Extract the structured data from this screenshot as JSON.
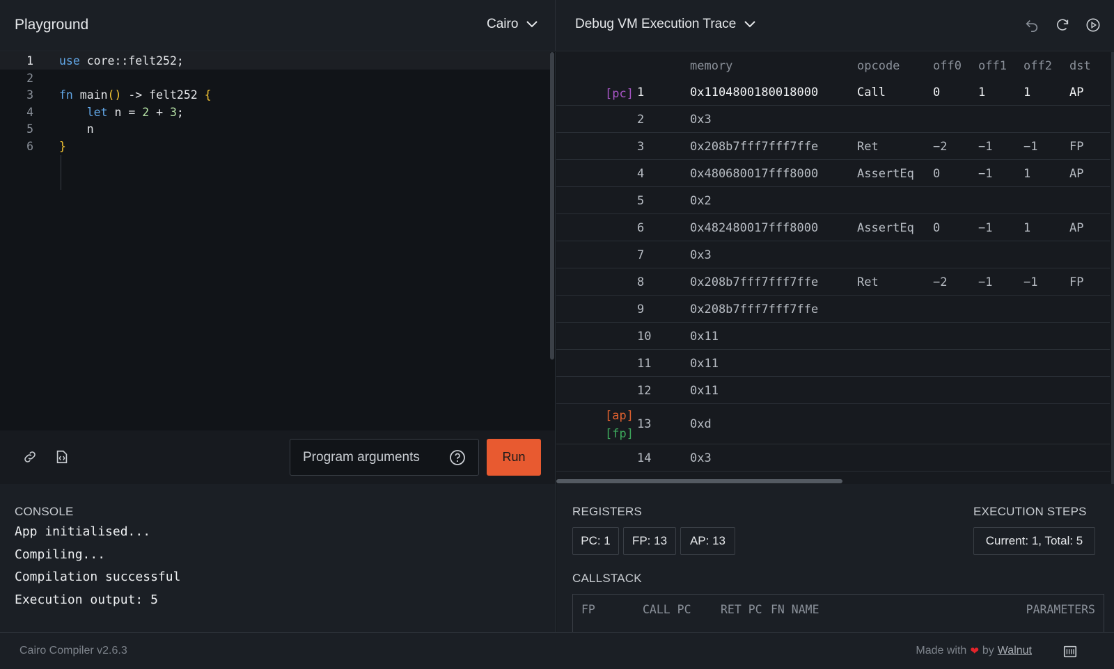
{
  "header": {
    "app_title": "Playground",
    "language": "Cairo",
    "mode": "Debug VM Execution Trace"
  },
  "editor": {
    "lines": [
      {
        "n": "1",
        "tokens": [
          {
            "t": "use",
            "k": "kw"
          },
          {
            "t": " core::felt252;",
            "k": ""
          }
        ]
      },
      {
        "n": "2",
        "tokens": []
      },
      {
        "n": "3",
        "tokens": [
          {
            "t": "fn",
            "k": "kw"
          },
          {
            "t": " main",
            "k": ""
          },
          {
            "t": "()",
            "k": "br"
          },
          {
            "t": " -> felt252 ",
            "k": ""
          },
          {
            "t": "{",
            "k": "br"
          }
        ]
      },
      {
        "n": "4",
        "tokens": [
          {
            "t": "    ",
            "k": ""
          },
          {
            "t": "let",
            "k": "kw"
          },
          {
            "t": " n = ",
            "k": ""
          },
          {
            "t": "2",
            "k": "num"
          },
          {
            "t": " + ",
            "k": ""
          },
          {
            "t": "3",
            "k": "num"
          },
          {
            "t": ";",
            "k": ""
          }
        ]
      },
      {
        "n": "5",
        "tokens": [
          {
            "t": "    n",
            "k": ""
          }
        ]
      },
      {
        "n": "6",
        "tokens": [
          {
            "t": "}",
            "k": "br"
          }
        ]
      }
    ]
  },
  "toolbar": {
    "args_placeholder": "Program arguments",
    "run_label": "Run"
  },
  "trace": {
    "headers": [
      "memory",
      "opcode",
      "off0",
      "off1",
      "off2",
      "dst"
    ],
    "rows": [
      {
        "regs": [
          {
            "label": "[pc]",
            "kind": "pc"
          }
        ],
        "idx": "1",
        "mem": "0x1104800180018000",
        "op": "Call",
        "off0": "0",
        "off1": "1",
        "off2": "1",
        "dst": "AP",
        "hl": true
      },
      {
        "regs": [],
        "idx": "2",
        "mem": "0x3",
        "op": "",
        "off0": "",
        "off1": "",
        "off2": "",
        "dst": ""
      },
      {
        "regs": [],
        "idx": "3",
        "mem": "0x208b7fff7fff7ffe",
        "op": "Ret",
        "off0": "−2",
        "off1": "−1",
        "off2": "−1",
        "dst": "FP"
      },
      {
        "regs": [],
        "idx": "4",
        "mem": "0x480680017fff8000",
        "op": "AssertEq",
        "off0": "0",
        "off1": "−1",
        "off2": "1",
        "dst": "AP"
      },
      {
        "regs": [],
        "idx": "5",
        "mem": "0x2",
        "op": "",
        "off0": "",
        "off1": "",
        "off2": "",
        "dst": ""
      },
      {
        "regs": [],
        "idx": "6",
        "mem": "0x482480017fff8000",
        "op": "AssertEq",
        "off0": "0",
        "off1": "−1",
        "off2": "1",
        "dst": "AP"
      },
      {
        "regs": [],
        "idx": "7",
        "mem": "0x3",
        "op": "",
        "off0": "",
        "off1": "",
        "off2": "",
        "dst": ""
      },
      {
        "regs": [],
        "idx": "8",
        "mem": "0x208b7fff7fff7ffe",
        "op": "Ret",
        "off0": "−2",
        "off1": "−1",
        "off2": "−1",
        "dst": "FP"
      },
      {
        "regs": [],
        "idx": "9",
        "mem": "0x208b7fff7fff7ffe",
        "op": "",
        "off0": "",
        "off1": "",
        "off2": "",
        "dst": ""
      },
      {
        "regs": [],
        "idx": "10",
        "mem": "0x11",
        "op": "",
        "off0": "",
        "off1": "",
        "off2": "",
        "dst": ""
      },
      {
        "regs": [],
        "idx": "11",
        "mem": "0x11",
        "op": "",
        "off0": "",
        "off1": "",
        "off2": "",
        "dst": ""
      },
      {
        "regs": [],
        "idx": "12",
        "mem": "0x11",
        "op": "",
        "off0": "",
        "off1": "",
        "off2": "",
        "dst": ""
      },
      {
        "regs": [
          {
            "label": "[ap]",
            "kind": "ap"
          },
          {
            "label": "[fp]",
            "kind": "fp"
          }
        ],
        "idx": "13",
        "mem": "0xd",
        "op": "",
        "off0": "",
        "off1": "",
        "off2": "",
        "dst": ""
      },
      {
        "regs": [],
        "idx": "14",
        "mem": "0x3",
        "op": "",
        "off0": "",
        "off1": "",
        "off2": "",
        "dst": ""
      }
    ]
  },
  "console": {
    "title": "CONSOLE",
    "lines": [
      "App initialised...",
      "Compiling...",
      "Compilation successful",
      "Execution output: 5"
    ]
  },
  "info": {
    "registers_title": "REGISTERS",
    "registers": [
      "PC: 1",
      "FP: 13",
      "AP: 13"
    ],
    "steps_title": "EXECUTION STEPS",
    "steps": "Current: 1, Total: 5",
    "callstack_title": "CALLSTACK",
    "callstack_headers": [
      "FP",
      "CALL PC",
      "RET PC",
      "FN NAME",
      "PARAMETERS"
    ]
  },
  "footer": {
    "version": "Cairo Compiler v2.6.3",
    "made_with": "Made with",
    "by": "by",
    "author": "Walnut"
  },
  "colors": {
    "accent": "#e85a30",
    "pc": "#a855c6",
    "ap": "#e0612f",
    "fp": "#3ea95c"
  }
}
